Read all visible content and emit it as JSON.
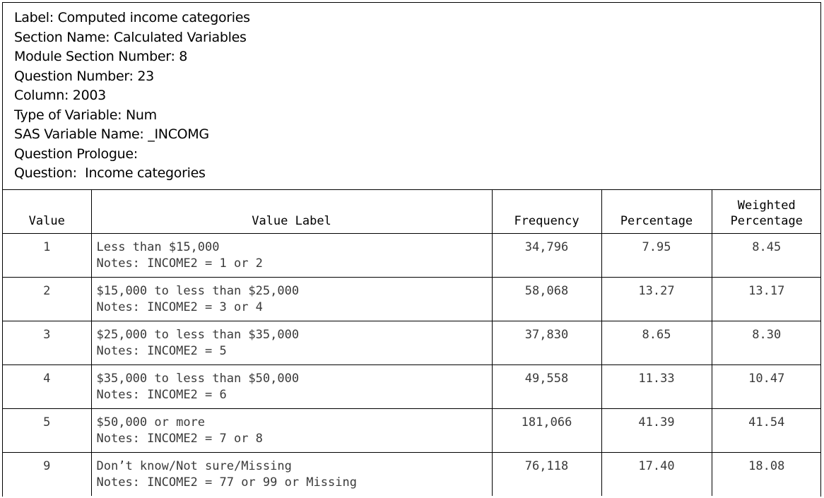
{
  "metadata": {
    "label": "Label: Computed income categories",
    "section_name": "Section Name: Calculated Variables",
    "module_section_number": "Module Section Number: 8",
    "question_number": "Question Number: 23",
    "column": "Column: 2003",
    "type_of_variable": "Type of Variable: Num",
    "sas_variable_name": "SAS Variable Name: _INCOMG",
    "question_prologue": "Question Prologue:",
    "question": "Question:  Income categories"
  },
  "table": {
    "headers": {
      "value": "Value",
      "value_label": "Value Label",
      "frequency": "Frequency",
      "percentage": "Percentage",
      "weighted_line1": "Weighted",
      "weighted_line2": "Percentage"
    },
    "rows": [
      {
        "value": "1",
        "label": "Less than $15,000",
        "notes": "Notes: INCOME2 = 1 or 2",
        "frequency": "34,796",
        "percentage": "7.95",
        "weighted": "8.45"
      },
      {
        "value": "2",
        "label": "$15,000 to less than $25,000",
        "notes": "Notes: INCOME2 = 3 or 4",
        "frequency": "58,068",
        "percentage": "13.27",
        "weighted": "13.17"
      },
      {
        "value": "3",
        "label": "$25,000 to less than $35,000",
        "notes": "Notes: INCOME2 = 5",
        "frequency": "37,830",
        "percentage": "8.65",
        "weighted": "8.30"
      },
      {
        "value": "4",
        "label": "$35,000 to less than $50,000",
        "notes": "Notes: INCOME2 = 6",
        "frequency": "49,558",
        "percentage": "11.33",
        "weighted": "10.47"
      },
      {
        "value": "5",
        "label": "$50,000 or more",
        "notes": "Notes: INCOME2 = 7 or 8",
        "frequency": "181,066",
        "percentage": "41.39",
        "weighted": "41.54"
      },
      {
        "value": "9",
        "label": "Don’t know/Not sure/Missing",
        "notes": "Notes: INCOME2 = 77 or 99 or Missing",
        "frequency": "76,118",
        "percentage": "17.40",
        "weighted": "18.08"
      }
    ]
  }
}
